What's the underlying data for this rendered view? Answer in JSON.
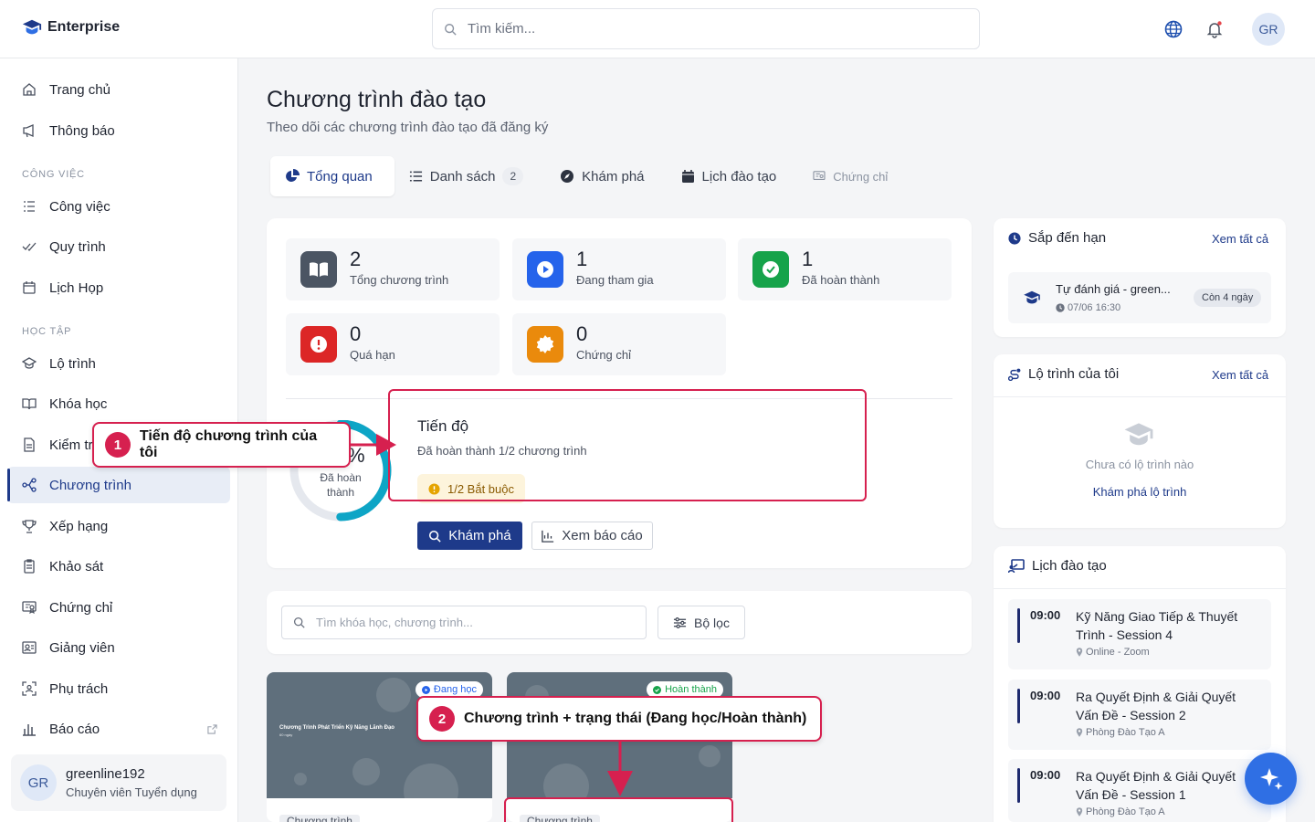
{
  "app": {
    "name": "Enterprise"
  },
  "search": {
    "placeholder": "Tìm kiếm..."
  },
  "user": {
    "initials": "GR",
    "name": "greenline192",
    "role": "Chuyên viên Tuyển dụng"
  },
  "sidebar": {
    "top_items": [
      {
        "label": "Trang chủ",
        "icon": "home-icon"
      },
      {
        "label": "Thông báo",
        "icon": "megaphone-icon"
      }
    ],
    "sections": [
      {
        "label": "CÔNG VIỆC",
        "items": [
          {
            "label": "Công việc",
            "icon": "task-list-icon"
          },
          {
            "label": "Quy trình",
            "icon": "check-process-icon"
          },
          {
            "label": "Lịch Họp",
            "icon": "calendar-icon"
          }
        ]
      },
      {
        "label": "HỌC TẬP",
        "items": [
          {
            "label": "Lộ trình",
            "icon": "graduation-cap-icon"
          },
          {
            "label": "Khóa học",
            "icon": "open-book-icon"
          },
          {
            "label": "Kiểm tra",
            "icon": "exam-doc-icon"
          },
          {
            "label": "Chương trình",
            "icon": "program-network-icon",
            "active": true
          },
          {
            "label": "Xếp hạng",
            "icon": "trophy-icon"
          },
          {
            "label": "Khảo sát",
            "icon": "clipboard-icon"
          },
          {
            "label": "Chứng chỉ",
            "icon": "certificate-icon"
          },
          {
            "label": "Giảng viên",
            "icon": "instructor-icon"
          },
          {
            "label": "Phụ trách",
            "icon": "scan-person-icon"
          },
          {
            "label": "Báo cáo",
            "icon": "bar-chart-icon"
          }
        ]
      }
    ]
  },
  "page": {
    "title": "Chương trình đào tạo",
    "subtitle": "Theo dõi các chương trình đào tạo đã đăng ký"
  },
  "tabs": [
    {
      "label": "Tổng quan",
      "icon": "pie-icon",
      "active": true
    },
    {
      "label": "Danh sách",
      "icon": "list-icon",
      "count": "2"
    },
    {
      "label": "Khám phá",
      "icon": "compass-icon"
    },
    {
      "label": "Lịch đào tạo",
      "icon": "calendar-filled-icon"
    },
    {
      "label": "Chứng chỉ",
      "icon": "certificate-icon"
    }
  ],
  "stats": [
    {
      "value": "2",
      "label": "Tổng chương trình",
      "color": "#4b5563",
      "icon": "book-icon"
    },
    {
      "value": "1",
      "label": "Đang tham gia",
      "color": "#2563eb",
      "icon": "play-icon"
    },
    {
      "value": "1",
      "label": "Đã hoàn thành",
      "color": "#16a34a",
      "icon": "check-circle-icon"
    },
    {
      "value": "0",
      "label": "Quá hạn",
      "color": "#dc2626",
      "icon": "alert-icon"
    },
    {
      "value": "0",
      "label": "Chứng chỉ",
      "color": "#ea8a0c",
      "icon": "badge-icon"
    }
  ],
  "progress": {
    "percent_text": "%",
    "percent_value": 50,
    "donut_label": "Đã hoàn thành",
    "title": "Tiến độ",
    "subtitle": "Đã hoàn thành 1/2 chương trình",
    "required_badge": "1/2 Bắt buộc",
    "explore_button": "Khám phá",
    "report_button": "Xem báo cáo",
    "accent": "#0ea5c6"
  },
  "annotations": [
    {
      "num": "1",
      "text": "Tiến độ chương trình của tôi"
    },
    {
      "num": "2",
      "text": "Chương trình + trạng thái (Đang học/Hoàn thành)"
    }
  ],
  "filter": {
    "placeholder": "Tìm khóa học, chương trình...",
    "button": "Bộ lọc"
  },
  "program_cards": [
    {
      "status": "Đang học",
      "status_color": "#2563eb",
      "cover_title": "Chương Trình Phát Triển Kỹ Năng Lãnh Đạo",
      "cover_sub": "60 ngày",
      "type": "Chương trình"
    },
    {
      "status": "Hoàn thành",
      "status_color": "#16a34a",
      "cover_title": "",
      "cover_sub": "",
      "type": "Chương trình"
    }
  ],
  "right": {
    "deadline": {
      "title": "Sắp đến hạn",
      "link": "Xem tất cả",
      "item": {
        "title": "Tự đánh giá - green...",
        "time": "07/06 16:30",
        "badge": "Còn 4 ngày"
      }
    },
    "paths": {
      "title": "Lộ trình của tôi",
      "link": "Xem tất cả",
      "empty": "Chưa có lộ trình nào",
      "cta": "Khám phá lộ trình"
    },
    "schedule": {
      "title": "Lịch đào tạo",
      "items": [
        {
          "time": "09:00",
          "title": "Kỹ Năng Giao Tiếp & Thuyết Trình - Session 4",
          "location": "Online - Zoom"
        },
        {
          "time": "09:00",
          "title": "Ra Quyết Định & Giải Quyết Vấn Đề - Session 2",
          "location": "Phòng Đào Tạo A"
        },
        {
          "time": "09:00",
          "title": "Ra Quyết Định & Giải Quyết Vấn Đề - Session 1",
          "location": "Phòng Đào Tạo A"
        }
      ]
    }
  }
}
